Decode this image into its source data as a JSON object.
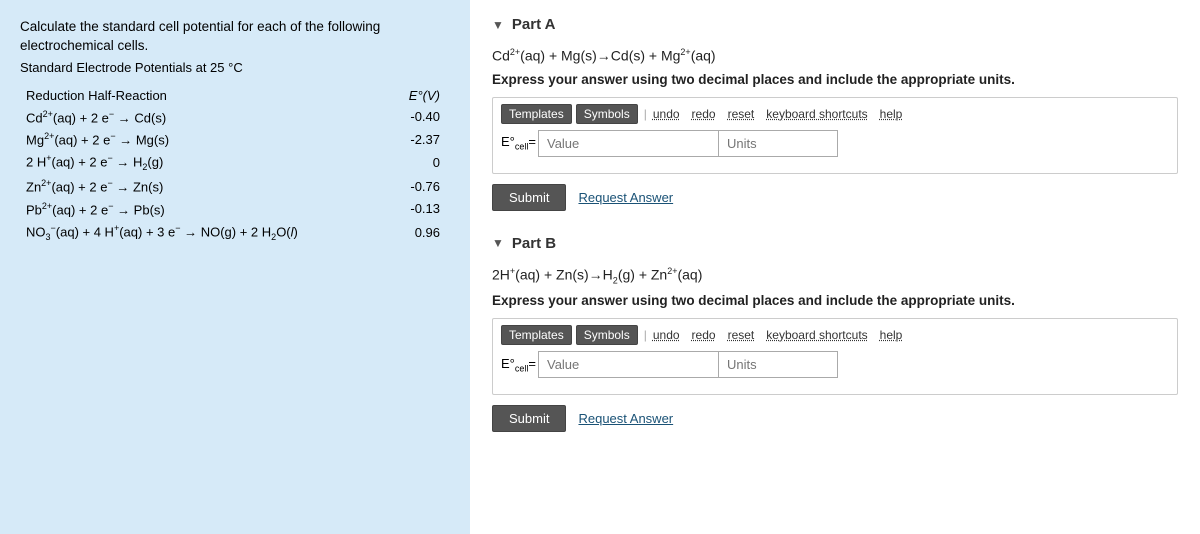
{
  "left": {
    "title_line1": "Calculate the standard cell potential for each of the following",
    "title_line2": "electrochemical cells.",
    "subtitle": "Standard Electrode Potentials at 25 °C",
    "col_header_reaction": "Reduction Half-Reaction",
    "col_header_potential": "E°(V)",
    "reactions": [
      {
        "reaction": "Cd²⁺(aq) + 2 e⁻ → Cd(s)",
        "potential": "-0.40"
      },
      {
        "reaction": "Mg²⁺(aq) + 2 e⁻ → Mg(s)",
        "potential": "-2.37"
      },
      {
        "reaction": "2 H⁺(aq) + 2 e⁻ → H₂(g)",
        "potential": "0"
      },
      {
        "reaction": "Zn²⁺(aq) + 2 e⁻ → Zn(s)",
        "potential": "-0.76"
      },
      {
        "reaction": "Pb²⁺(aq) + 2 e⁻ → Pb(s)",
        "potential": "-0.13"
      },
      {
        "reaction": "NO₃⁻(aq) + 4 H⁺(aq) + 3 e⁻ → NO(g) + 2 H₂O(l)",
        "potential": "0.96"
      }
    ]
  },
  "right": {
    "part_a": {
      "label": "Part A",
      "reaction": "Cd²⁺(aq) + Mg(s)→Cd(s) + Mg²⁺(aq)",
      "instruction": "Express your answer using two decimal places and include the appropriate units.",
      "toolbar": {
        "templates_label": "Templates",
        "symbols_label": "Symbols",
        "undo_label": "undo",
        "redo_label": "redo",
        "reset_label": "reset",
        "keyboard_label": "keyboard shortcuts",
        "help_label": "help"
      },
      "ecell_label": "E°cell=",
      "value_placeholder": "Value",
      "units_placeholder": "Units",
      "submit_label": "Submit",
      "request_answer_label": "Request Answer"
    },
    "part_b": {
      "label": "Part B",
      "reaction": "2H⁺(aq) + Zn(s)→H₂(g) + Zn²⁺(aq)",
      "instruction": "Express your answer using two decimal places and include the appropriate units.",
      "toolbar": {
        "templates_label": "Templates",
        "symbols_label": "Symbols",
        "undo_label": "undo",
        "redo_label": "redo",
        "reset_label": "reset",
        "keyboard_label": "keyboard shortcuts",
        "help_label": "help"
      },
      "ecell_label": "E°cell=",
      "value_placeholder": "Value",
      "units_placeholder": "Units",
      "submit_label": "Submit",
      "request_answer_label": "Request Answer"
    }
  }
}
